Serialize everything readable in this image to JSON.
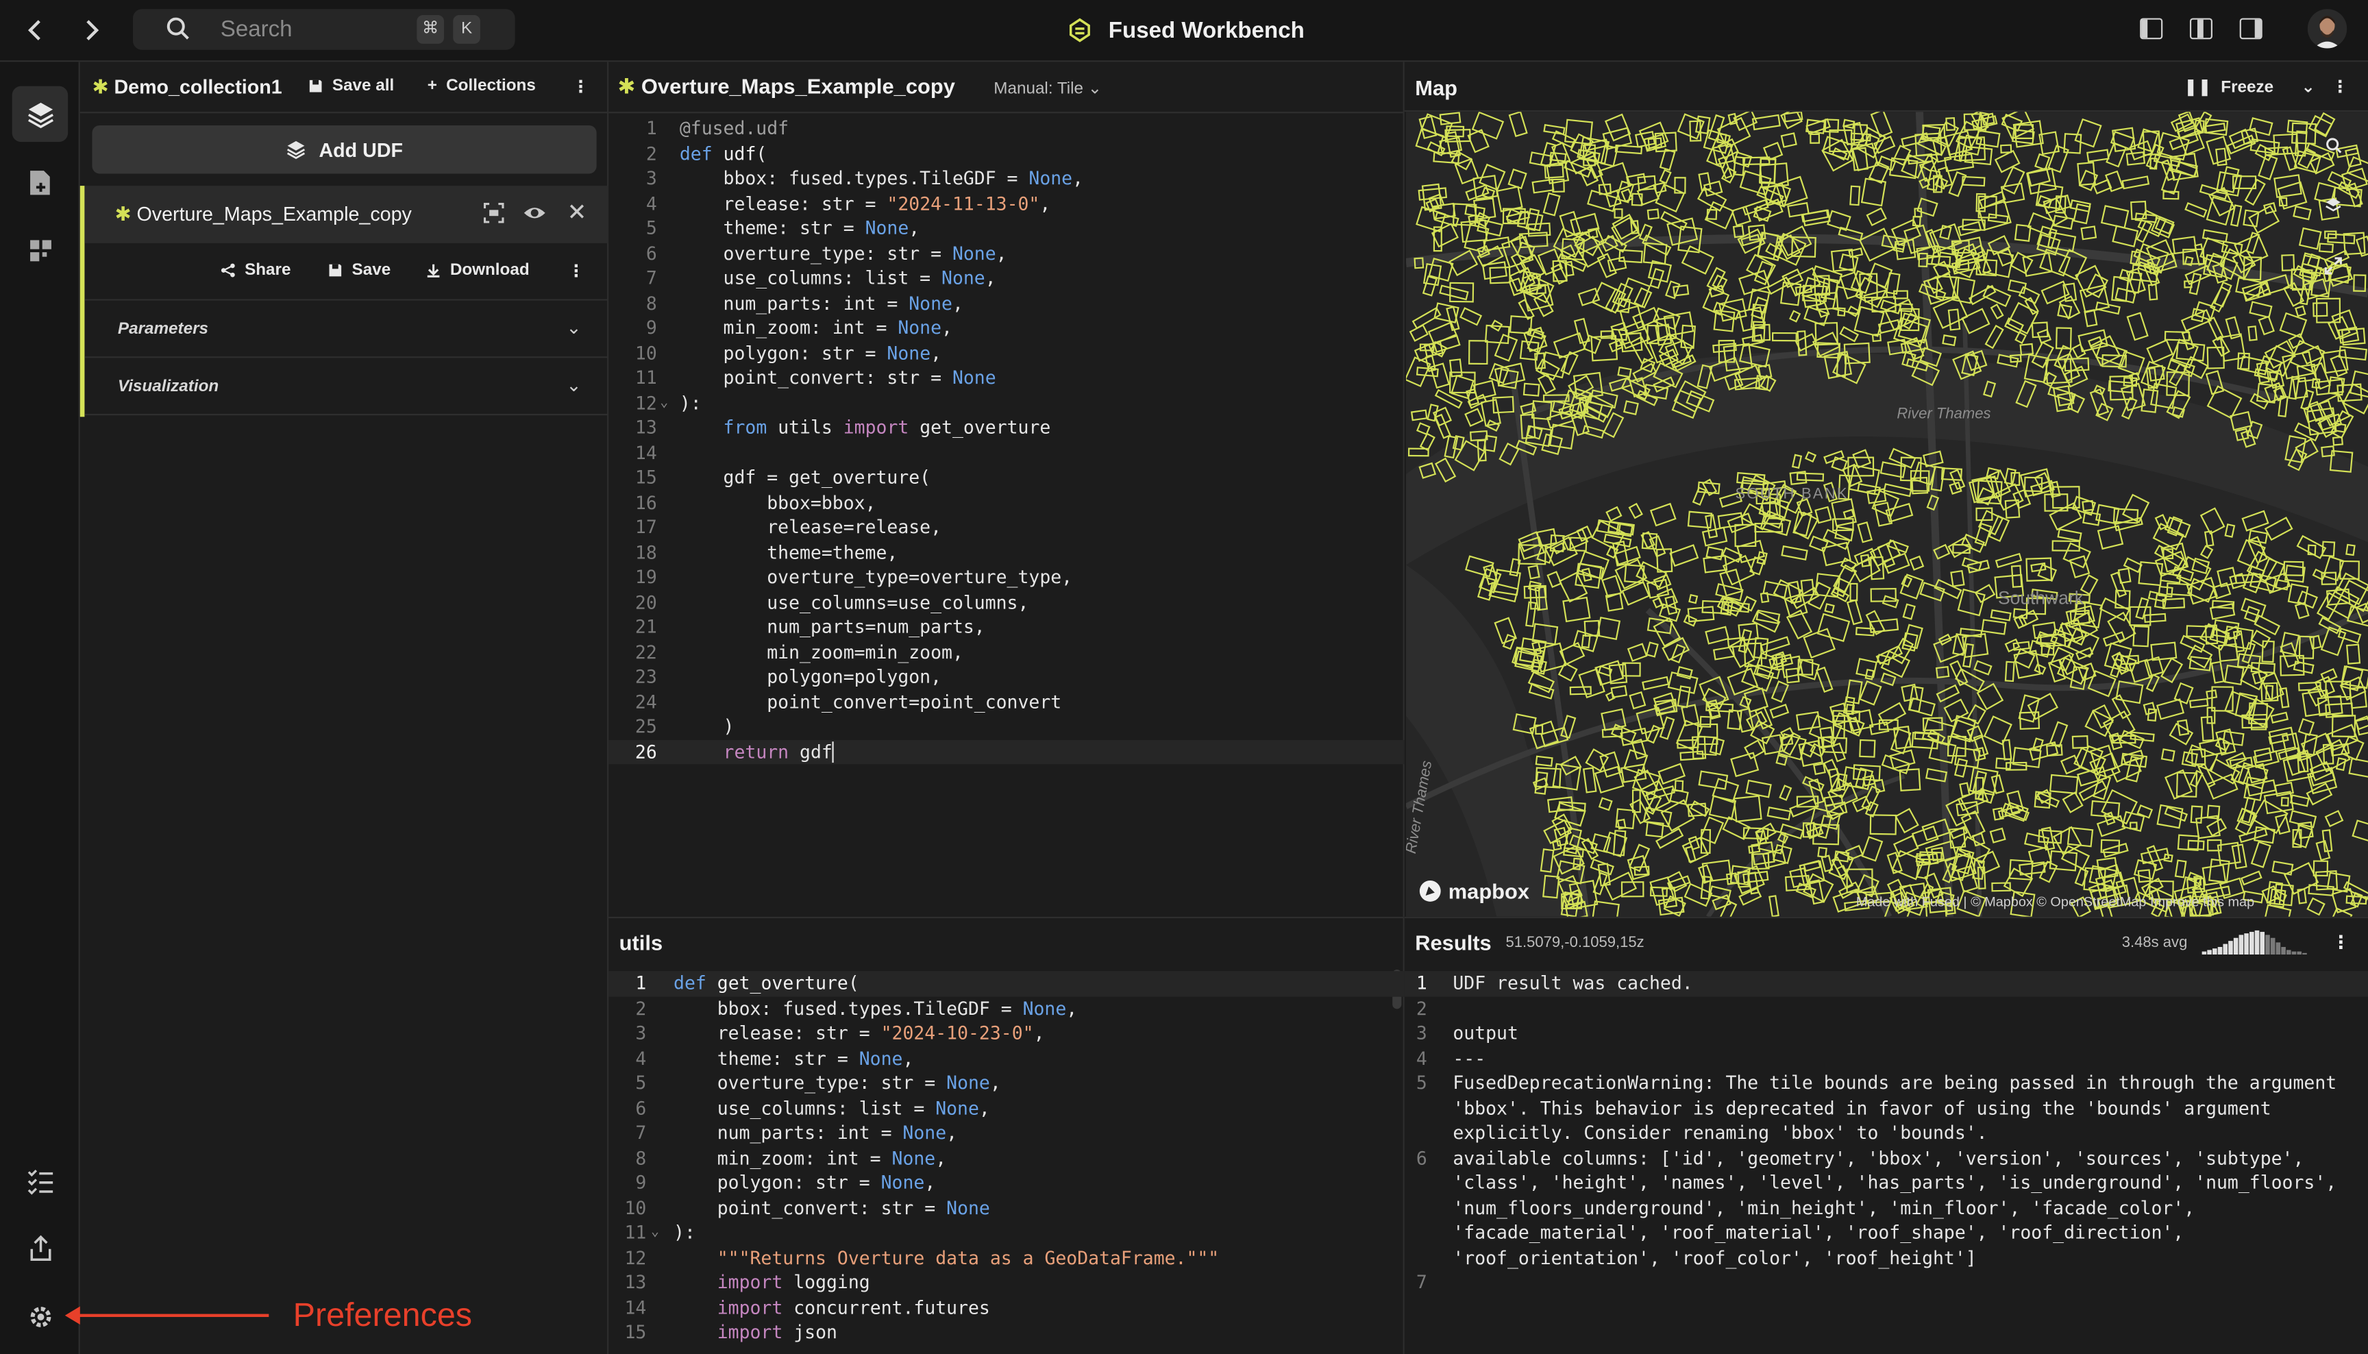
{
  "topbar": {
    "search_placeholder": "Search",
    "kbd_cmd": "⌘",
    "kbd_k": "K",
    "app_title": "Fused Workbench"
  },
  "collection": {
    "name": "Demo_collection1",
    "save_all": "Save all",
    "collections": "Collections",
    "add_udf": "Add UDF",
    "udf_name": "Overture_Maps_Example_copy",
    "share": "Share",
    "save": "Save",
    "download": "Download",
    "parameters": "Parameters",
    "visualization": "Visualization"
  },
  "editor": {
    "title": "Overture_Maps_Example_copy",
    "mode": "Manual: Tile",
    "current_line": 26
  },
  "utils": {
    "title": "utils"
  },
  "map": {
    "title": "Map",
    "freeze": "Freeze",
    "logo": "mapbox",
    "attribution": "Made with Fused | © Mapbox © OpenStreetMap Improve this map",
    "labels": [
      "River Thames",
      "SOUTH BANK",
      "Southwark",
      "River Thames"
    ],
    "building_color": "#d4e157"
  },
  "results": {
    "title": "Results",
    "coord": "51.5079,-0.1059,15z",
    "avg": "3.48s avg",
    "lines": [
      "UDF result was cached.",
      "",
      "output",
      "---",
      "FusedDeprecationWarning: The tile bounds are being passed in through the argument",
      "'bbox'. This behavior is deprecated in favor of using the 'bounds' argument",
      "explicitly. Consider renaming 'bbox' to 'bounds'.",
      "available columns: ['id', 'geometry', 'bbox', 'version', 'sources', 'subtype',",
      "'class', 'height', 'names', 'level', 'has_parts', 'is_underground', 'num_floors',",
      "'num_floors_underground', 'min_height', 'min_floor', 'facade_color',",
      "'facade_material', 'roof_material', 'roof_shape', 'roof_direction',",
      "'roof_orientation', 'roof_color', 'roof_height']",
      ""
    ],
    "line_numbers": [
      "1",
      "2",
      "3",
      "4",
      "5",
      "",
      "",
      "6",
      "",
      "",
      "",
      "",
      "7"
    ]
  },
  "annotation": {
    "label": "Preferences",
    "color": "#e8402a"
  },
  "colors": {
    "accent": "#d4e157",
    "background": "#1c1c1c"
  }
}
